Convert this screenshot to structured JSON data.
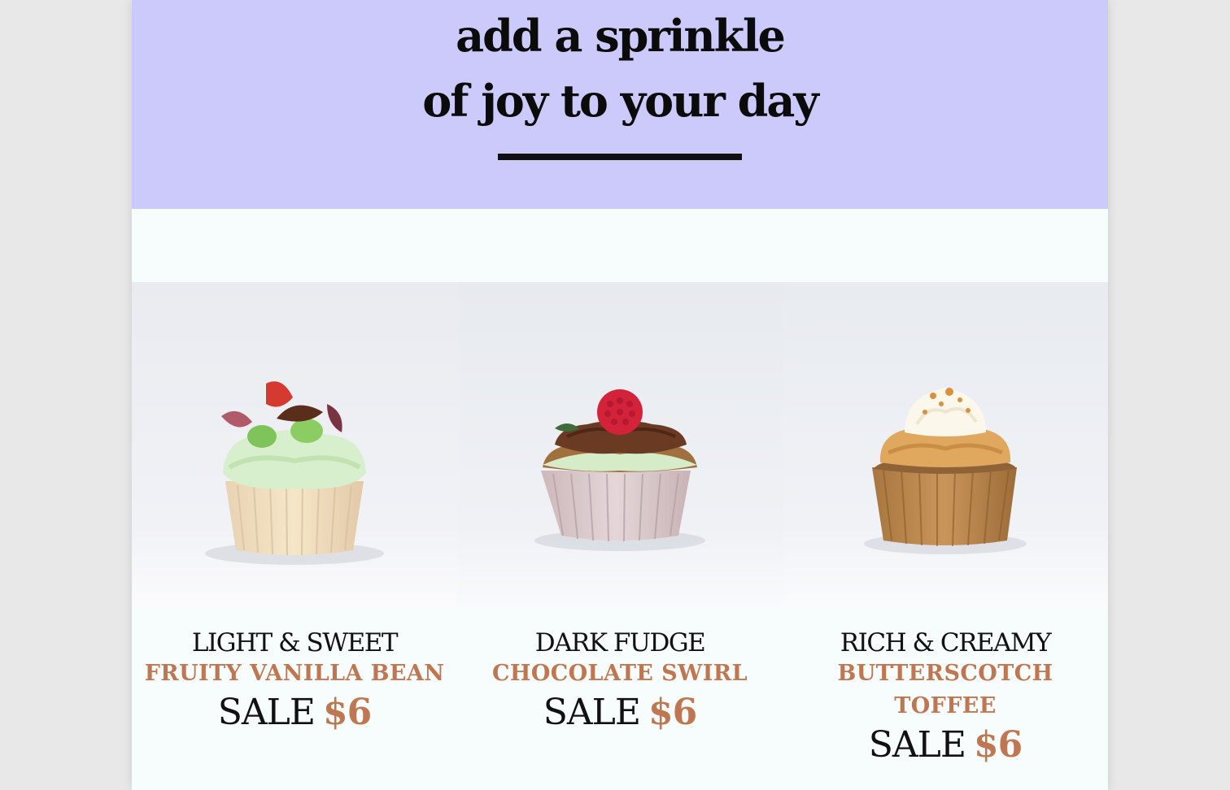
{
  "hero": {
    "line1": "add a sprinkle",
    "line2": "of joy to your day"
  },
  "products": [
    {
      "tagline": "LIGHT & SWEET",
      "flavor": "FRUITY VANILLA BEAN",
      "sale_label": "SALE",
      "price": "$6",
      "image": "cupcake-vanilla-photo"
    },
    {
      "tagline": "DARK FUDGE",
      "flavor": "CHOCOLATE SWIRL",
      "sale_label": "SALE",
      "price": "$6",
      "image": "cupcake-chocolate-photo"
    },
    {
      "tagline": "RICH & CREAMY",
      "flavor": "BUTTERSCOTCH TOFFEE",
      "sale_label": "SALE",
      "price": "$6",
      "image": "cupcake-butterscotch-photo"
    }
  ],
  "colors": {
    "hero_bg": "#cbcafb",
    "accent": "#bf7752",
    "page_bg": "#f7fcfc"
  }
}
